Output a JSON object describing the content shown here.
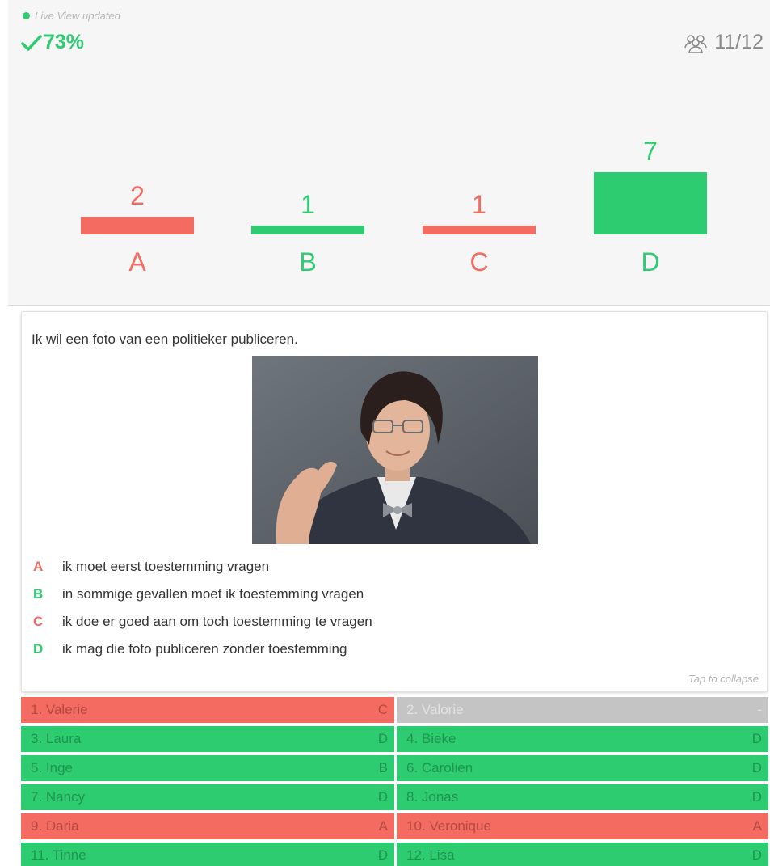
{
  "status": {
    "live_text": "Live View updated"
  },
  "score": {
    "value": "73%",
    "icon": "check-icon"
  },
  "participants": {
    "icon": "group-icon",
    "count": "11/12"
  },
  "colors": {
    "correct": "#2ecc71",
    "incorrect": "#f46b62",
    "no_answer": "#c4c4c4"
  },
  "chart_data": {
    "type": "bar",
    "categories": [
      "A",
      "B",
      "C",
      "D"
    ],
    "values": [
      2,
      1,
      1,
      7
    ],
    "correct": [
      false,
      true,
      false,
      true
    ]
  },
  "question": {
    "text": "Ik wil een foto van een politieker publiceren.",
    "image": "portrait-photo-politician",
    "answers": [
      {
        "letter": "A",
        "text": "ik moet eerst toestemming vragen",
        "status": "wrong"
      },
      {
        "letter": "B",
        "text": "in sommige gevallen moet ik toestemming vragen",
        "status": "right"
      },
      {
        "letter": "C",
        "text": "ik doe er goed aan om toch toestemming te vragen",
        "status": "wrong"
      },
      {
        "letter": "D",
        "text": "ik mag die foto publiceren zonder toestemming",
        "status": "right"
      }
    ],
    "collapse_text": "Tap to collapse"
  },
  "students": [
    {
      "name": "1. Valerie",
      "answer": "C",
      "status": "wrong"
    },
    {
      "name": "2. Valorie",
      "answer": "-",
      "status": "none"
    },
    {
      "name": "3. Laura",
      "answer": "D",
      "status": "right"
    },
    {
      "name": "4. Bieke",
      "answer": "D",
      "status": "right"
    },
    {
      "name": "5. Inge",
      "answer": "B",
      "status": "right"
    },
    {
      "name": "6. Carolien",
      "answer": "D",
      "status": "right"
    },
    {
      "name": "7. Nancy",
      "answer": "D",
      "status": "right"
    },
    {
      "name": "8. Jonas",
      "answer": "D",
      "status": "right"
    },
    {
      "name": "9. Daria",
      "answer": "A",
      "status": "wrong"
    },
    {
      "name": "10. Veronique",
      "answer": "A",
      "status": "wrong"
    },
    {
      "name": "11. Tinne",
      "answer": "D",
      "status": "right"
    },
    {
      "name": "12. Lisa",
      "answer": "D",
      "status": "right"
    }
  ]
}
